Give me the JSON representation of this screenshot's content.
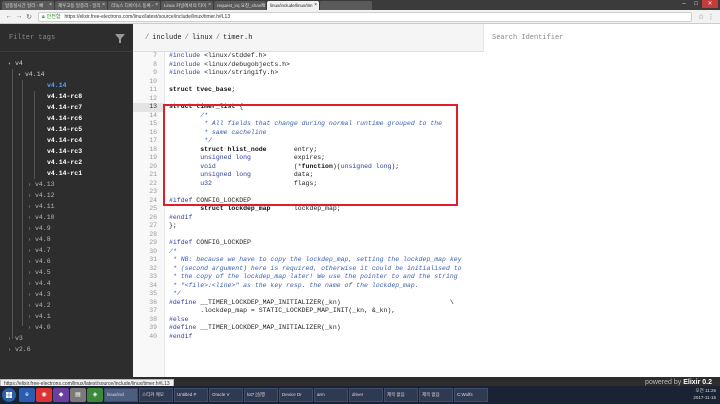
{
  "browser": {
    "tabs": [
      {
        "label": "일종실시간 일리 - 빠"
      },
      {
        "label": "제우고등 일종리 - 일리"
      },
      {
        "label": "리눅스 디바이스 동록 -"
      },
      {
        "label": "Linux 커널에서의 타이"
      },
      {
        "label": "request_irq 요청_shared"
      },
      {
        "label": "linux/include/linux/tim",
        "active": true
      },
      {
        "label": ""
      }
    ],
    "secure_label": "안전함",
    "url": "https://elixir.free-electrons.com/linux/latest/source/include/linux/timer.h#L13"
  },
  "sidebar": {
    "filter_placeholder": "Filter tags",
    "tree": [
      {
        "label": "v4",
        "kind": "root"
      },
      {
        "label": "v4.14",
        "kind": "open"
      },
      {
        "label": "v4.14",
        "kind": "sel"
      },
      {
        "label": "v4.14-rc8",
        "kind": "child"
      },
      {
        "label": "v4.14-rc7",
        "kind": "child"
      },
      {
        "label": "v4.14-rc6",
        "kind": "child"
      },
      {
        "label": "v4.14-rc5",
        "kind": "child"
      },
      {
        "label": "v4.14-rc4",
        "kind": "child"
      },
      {
        "label": "v4.14-rc3",
        "kind": "child"
      },
      {
        "label": "v4.14-rc2",
        "kind": "child"
      },
      {
        "label": "v4.14-rc1",
        "kind": "child"
      },
      {
        "label": "v4.13",
        "kind": "collapsed"
      },
      {
        "label": "v4.12",
        "kind": "collapsed"
      },
      {
        "label": "v4.11",
        "kind": "collapsed"
      },
      {
        "label": "v4.10",
        "kind": "collapsed"
      },
      {
        "label": "v4.9",
        "kind": "collapsed"
      },
      {
        "label": "v4.8",
        "kind": "collapsed"
      },
      {
        "label": "v4.7",
        "kind": "collapsed"
      },
      {
        "label": "v4.6",
        "kind": "collapsed"
      },
      {
        "label": "v4.5",
        "kind": "collapsed"
      },
      {
        "label": "v4.4",
        "kind": "collapsed"
      },
      {
        "label": "v4.3",
        "kind": "collapsed"
      },
      {
        "label": "v4.2",
        "kind": "collapsed"
      },
      {
        "label": "v4.1",
        "kind": "collapsed"
      },
      {
        "label": "v4.0",
        "kind": "collapsed"
      },
      {
        "label": "v3",
        "kind": "root-collapsed"
      },
      {
        "label": "v2.6",
        "kind": "root-collapsed"
      }
    ]
  },
  "header": {
    "breadcrumb": [
      "include",
      "linux",
      "timer.h"
    ],
    "search_placeholder": "Search Identifier"
  },
  "code": {
    "highlighted_line": 13,
    "lines": [
      {
        "n": "7",
        "t": "#include <linux/stddef.h>"
      },
      {
        "n": "8",
        "t": "#include <linux/debugobjects.h>"
      },
      {
        "n": "9",
        "t": "#include <linux/stringify.h>"
      },
      {
        "n": "10",
        "t": ""
      },
      {
        "n": "11",
        "t": "struct tvec_base;"
      },
      {
        "n": "12",
        "t": ""
      },
      {
        "n": "13",
        "t": "struct timer_list {"
      },
      {
        "n": "14",
        "t": "        /*"
      },
      {
        "n": "15",
        "t": "         * All fields that change during normal runtime grouped to the"
      },
      {
        "n": "16",
        "t": "         * same cacheline"
      },
      {
        "n": "17",
        "t": "         */"
      },
      {
        "n": "18",
        "t": "        struct hlist_node       entry;"
      },
      {
        "n": "19",
        "t": "        unsigned long           expires;"
      },
      {
        "n": "20",
        "t": "        void                    (*function)(unsigned long);"
      },
      {
        "n": "21",
        "t": "        unsigned long           data;"
      },
      {
        "n": "22",
        "t": "        u32                     flags;"
      },
      {
        "n": "23",
        "t": ""
      },
      {
        "n": "24",
        "t": "#ifdef CONFIG_LOCKDEP"
      },
      {
        "n": "25",
        "t": "        struct lockdep_map      lockdep_map;"
      },
      {
        "n": "26",
        "t": "#endif"
      },
      {
        "n": "27",
        "t": "};"
      },
      {
        "n": "28",
        "t": ""
      },
      {
        "n": "29",
        "t": "#ifdef CONFIG_LOCKDEP"
      },
      {
        "n": "30",
        "t": "/*"
      },
      {
        "n": "31",
        "t": " * NB: because we have to copy the lockdep_map, setting the lockdep_map key"
      },
      {
        "n": "32",
        "t": " * (second argument) here is required, otherwise it could be initialised to"
      },
      {
        "n": "33",
        "t": " * the copy of the lockdep_map later! We use the pointer to and the string"
      },
      {
        "n": "34",
        "t": " * \"<file>:<line>\" as the key resp. the name of the lockdep_map."
      },
      {
        "n": "35",
        "t": " */"
      },
      {
        "n": "36",
        "t": "#define __TIMER_LOCKDEP_MAP_INITIALIZER(_kn)                            \\"
      },
      {
        "n": "37",
        "t": "        .lockdep_map = STATIC_LOCKDEP_MAP_INIT(_kn, &_kn),"
      },
      {
        "n": "38",
        "t": "#else"
      },
      {
        "n": "39",
        "t": "#define __TIMER_LOCKDEP_MAP_INITIALIZER(_kn)"
      },
      {
        "n": "40",
        "t": "#endif"
      }
    ]
  },
  "footer": {
    "status_url": "https://elixir.free-electrons.com/linux/latest/source/include/linux/timer.h#L13",
    "powered_by": "powered by",
    "brand": "Elixir 0.2"
  },
  "taskbar": {
    "apps": [
      {
        "label": "linux/incl",
        "active": true
      },
      {
        "label": "스티커 메모"
      },
      {
        "label": "Untitled P"
      },
      {
        "label": "Oracle V"
      },
      {
        "label": "lot7 [실행"
      },
      {
        "label": "Device Dr"
      },
      {
        "label": "arm"
      },
      {
        "label": "driver"
      },
      {
        "label": "제목 없음"
      },
      {
        "label": "제목 없음"
      },
      {
        "label": "C:Wolfs"
      }
    ],
    "clock_time": "오전 11:26",
    "clock_date": "2017-11-15"
  }
}
